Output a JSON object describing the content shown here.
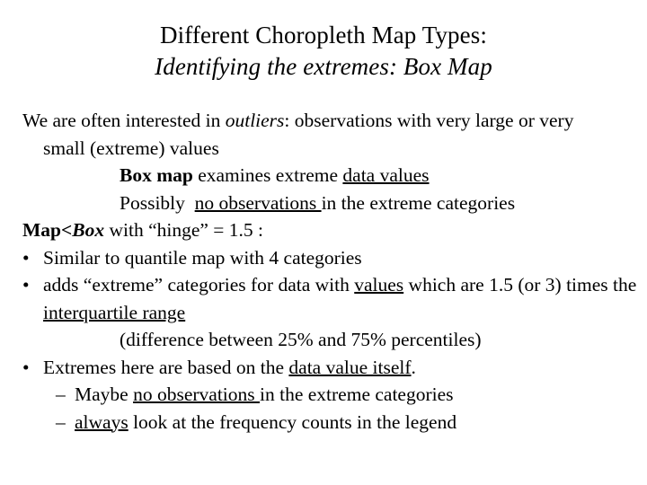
{
  "slide": {
    "title": {
      "line1": "Different Choropleth Map Types:",
      "line2": "Identifying the extremes: Box Map"
    },
    "body": {
      "para1": {
        "seg1": "We are often interested in ",
        "seg2_italic": "outliers",
        "seg3": ": observations with very large or very ",
        "wrap": "small (extreme) values"
      },
      "line_boxmap": {
        "seg1_bold": "Box map",
        "seg2": " examines extreme ",
        "seg3_underline": "data values"
      },
      "line_possibly": {
        "seg1": "Possibly  ",
        "seg2_underline": "no observations ",
        "seg3": "in the extreme categories"
      },
      "line_mapbox": {
        "seg1_bold": "Map<",
        "seg2_bolditalic": "Box",
        "seg3": " with “hinge” = 1.5 :"
      },
      "bullet1": {
        "marker": "•",
        "text": "Similar to quantile map with 4 categories"
      },
      "bullet2": {
        "marker": "•",
        "seg1": "adds “extreme” categories for data with ",
        "seg2_underline": "values",
        "seg3": " which are 1.5 (or 3) times the ",
        "seg4_underline": "interquartile range"
      },
      "line_difference": "(difference between 25% and 75% percentiles)",
      "bullet3": {
        "marker": "•",
        "seg1": "Extremes here are based on the ",
        "seg2_underline": "data value itself",
        "seg3": "."
      },
      "subbullet1": {
        "marker": "–",
        "seg1": "Maybe ",
        "seg2_underline": "no observations ",
        "seg3": "in the extreme categories"
      },
      "subbullet2": {
        "marker": "–",
        "seg1_underline": "always",
        "seg2": " look at the frequency counts in the legend"
      }
    }
  },
  "colors": {
    "background": "#ffffff",
    "text": "#000000"
  }
}
